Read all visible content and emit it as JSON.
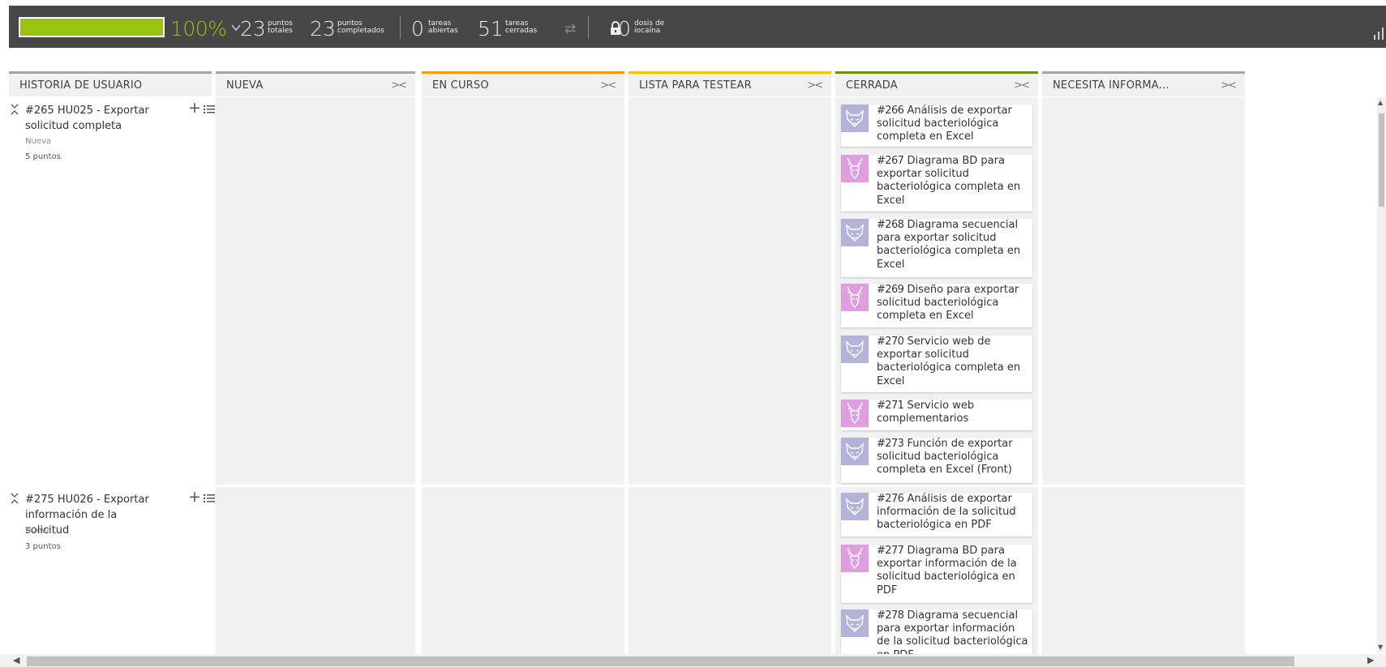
{
  "topbar": {
    "progress_percent": 100,
    "progress_label": "100%",
    "stats": [
      {
        "value": "23",
        "label_line1": "puntos",
        "label_line2": "totales"
      },
      {
        "value": "23",
        "label_line1": "puntos",
        "label_line2": "completados"
      },
      {
        "value": "0",
        "label_line1": "tareas",
        "label_line2": "abiertas"
      },
      {
        "value": "51",
        "label_line1": "tareas",
        "label_line2": "cerradas"
      },
      {
        "value": "0",
        "label_line1": "dosis de",
        "label_line2": "iocaína"
      }
    ],
    "icons": [
      "chevron-down-icon",
      "swap-icon",
      "lock-icon",
      "signal-bars-icon"
    ],
    "progress_color": "#9ac311",
    "bar_bg": "#474747"
  },
  "columns": [
    {
      "title": "HISTORIA DE USUARIO",
      "color": "#a5a5a5",
      "fold": ""
    },
    {
      "title": "NUEVA",
      "color": "#a5a5a5",
      "fold": "><"
    },
    {
      "title": "EN CURSO",
      "color": "#ff9900",
      "fold": "><"
    },
    {
      "title": "LISTA PARA TESTEAR",
      "color": "#fcc000",
      "fold": "><"
    },
    {
      "title": "CERRADA",
      "color": "#669900",
      "fold": "><"
    },
    {
      "title": "NECESITA INFORMA...",
      "color": "#a5a5a5",
      "fold": "><"
    }
  ],
  "stories": [
    {
      "title": "#265 HU025 - Exportar solicitud completa",
      "status": "Nueva",
      "points": "5 puntos"
    },
    {
      "title": "#275 HU026 - Exportar información de la solicitud",
      "status": "Nueva",
      "points": "3 puntos"
    }
  ],
  "cards": [
    {
      "ref": "#266",
      "text": "Análisis de exportar solicitud bacteriológica completa en Excel",
      "avatar": "wolf-avatar-icon",
      "avatar_color": "#b3b3d9"
    },
    {
      "ref": "#267",
      "text": "Diagrama BD para exportar solicitud bacteriológica completa en Excel",
      "avatar": "deer-avatar-icon",
      "avatar_color": "#e09ee0"
    },
    {
      "ref": "#268",
      "text": "Diagrama secuencial para exportar solicitud bacteriológica completa en Excel",
      "avatar": "wolf-avatar-icon",
      "avatar_color": "#b3b3d9"
    },
    {
      "ref": "#269",
      "text": "Diseño para exportar solicitud bacteriológica completa en Excel",
      "avatar": "deer-avatar-icon",
      "avatar_color": "#e09ee0"
    },
    {
      "ref": "#270",
      "text": "Servicio web de exportar solicitud bacteriológica completa en Excel",
      "avatar": "wolf-avatar-icon",
      "avatar_color": "#b3b3d9"
    },
    {
      "ref": "#271",
      "text": "Servicio web complementarios",
      "avatar": "deer-avatar-icon",
      "avatar_color": "#e09ee0"
    },
    {
      "ref": "#273",
      "text": "Función de exportar solicitud bacteriológica completa en Excel (Front)",
      "avatar": "wolf-avatar-icon",
      "avatar_color": "#b3b3d9"
    },
    {
      "ref": "#276",
      "text": "Análisis de exportar información de la solicitud bacteriológica en PDF",
      "avatar": "wolf-avatar-icon",
      "avatar_color": "#b3b3d9"
    },
    {
      "ref": "#277",
      "text": "Diagrama BD para exportar información de la solicitud bacteriológica en PDF",
      "avatar": "deer-avatar-icon",
      "avatar_color": "#e09ee0"
    },
    {
      "ref": "#278",
      "text": "Diagrama secuencial para exportar información de la solicitud bacteriológica en PDF",
      "avatar": "wolf-avatar-icon",
      "avatar_color": "#b3b3d9"
    }
  ]
}
